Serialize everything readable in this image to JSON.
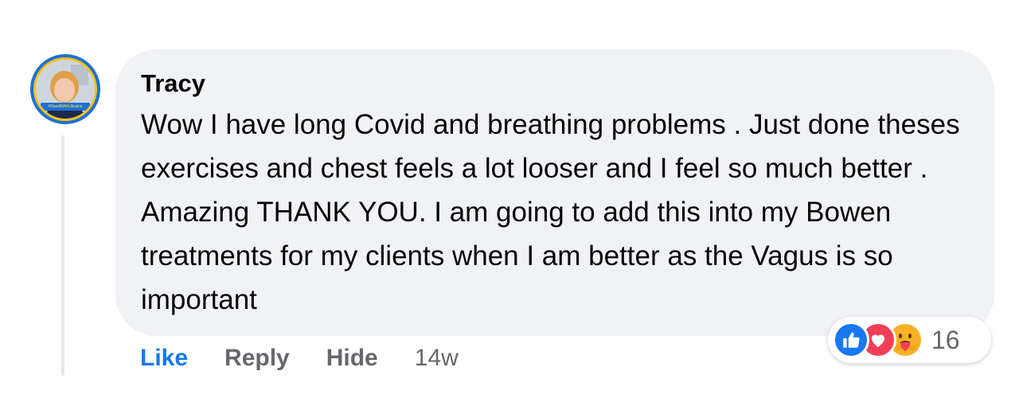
{
  "comment": {
    "author": "Tracy",
    "text": "Wow I have long Covid and breathing problems . Just done theses exercises and chest feels a lot looser and I feel so much better . Amazing THANK YOU. I am going to add this into my Bowen treatments for my clients when I am better as the Vagus is so important",
    "avatar_banner_text": "#StandWithUkraine",
    "avatar_frame_color": "#f2c418",
    "avatar_ring_color": "#1f6fd6"
  },
  "reactions": {
    "types": [
      "like-icon",
      "love-icon",
      "care-icon"
    ],
    "count": "16"
  },
  "actions": {
    "like_label": "Like",
    "reply_label": "Reply",
    "hide_label": "Hide",
    "timestamp": "14w"
  },
  "colors": {
    "bubble_bg": "#f0f2f5",
    "like_active": "#1877f2",
    "secondary_text": "#65676b",
    "love": "#f33e58",
    "care": "#f7b125"
  }
}
